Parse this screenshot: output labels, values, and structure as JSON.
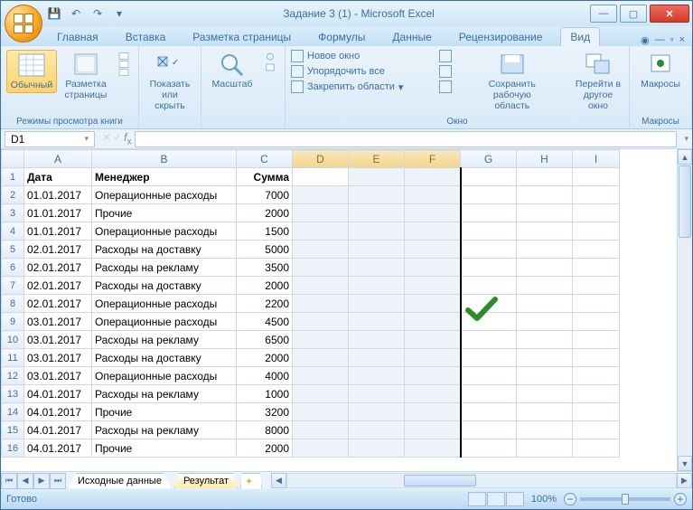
{
  "title": "Задание 3 (1) - Microsoft Excel",
  "tabs": {
    "home": "Главная",
    "insert": "Вставка",
    "layout": "Разметка страницы",
    "formulas": "Формулы",
    "data": "Данные",
    "review": "Рецензирование",
    "view": "Вид"
  },
  "ribbon": {
    "normal": "Обычный",
    "page_layout": "Разметка\nстраницы",
    "views_group": "Режимы просмотра книги",
    "show_hide": "Показать\nили скрыть",
    "zoom": "Масштаб",
    "new_window": "Новое окно",
    "arrange_all": "Упорядочить все",
    "freeze_panes": "Закрепить области",
    "window_group": "Окно",
    "save_workspace": "Сохранить\nрабочую область",
    "switch_windows": "Перейти в\nдругое окно",
    "macros": "Макросы",
    "macros_group": "Макросы"
  },
  "namebox": "D1",
  "columns": [
    "A",
    "B",
    "C",
    "D",
    "E",
    "F",
    "G",
    "H",
    "I"
  ],
  "headers": {
    "a": "Дата",
    "b": "Менеджер",
    "c": "Сумма"
  },
  "rows": [
    {
      "n": 2,
      "a": "01.01.2017",
      "b": "Операционные расходы",
      "c": "7000"
    },
    {
      "n": 3,
      "a": "01.01.2017",
      "b": "Прочие",
      "c": "2000"
    },
    {
      "n": 4,
      "a": "01.01.2017",
      "b": "Операционные расходы",
      "c": "1500"
    },
    {
      "n": 5,
      "a": "02.01.2017",
      "b": "Расходы на доставку",
      "c": "5000"
    },
    {
      "n": 6,
      "a": "02.01.2017",
      "b": "Расходы на рекламу",
      "c": "3500"
    },
    {
      "n": 7,
      "a": "02.01.2017",
      "b": "Расходы на доставку",
      "c": "2000"
    },
    {
      "n": 8,
      "a": "02.01.2017",
      "b": "Операционные расходы",
      "c": "2200"
    },
    {
      "n": 9,
      "a": "03.01.2017",
      "b": "Операционные расходы",
      "c": "4500"
    },
    {
      "n": 10,
      "a": "03.01.2017",
      "b": "Расходы на рекламу",
      "c": "6500"
    },
    {
      "n": 11,
      "a": "03.01.2017",
      "b": "Расходы на доставку",
      "c": "2000"
    },
    {
      "n": 12,
      "a": "03.01.2017",
      "b": "Операционные расходы",
      "c": "4000"
    },
    {
      "n": 13,
      "a": "04.01.2017",
      "b": "Расходы на рекламу",
      "c": "1000"
    },
    {
      "n": 14,
      "a": "04.01.2017",
      "b": "Прочие",
      "c": "3200"
    },
    {
      "n": 15,
      "a": "04.01.2017",
      "b": "Расходы на рекламу",
      "c": "8000"
    },
    {
      "n": 16,
      "a": "04.01.2017",
      "b": "Прочие",
      "c": "2000"
    }
  ],
  "sheet_tabs": {
    "source": "Исходные данные",
    "result": "Результат"
  },
  "status": {
    "ready": "Готово",
    "zoom": "100%"
  }
}
